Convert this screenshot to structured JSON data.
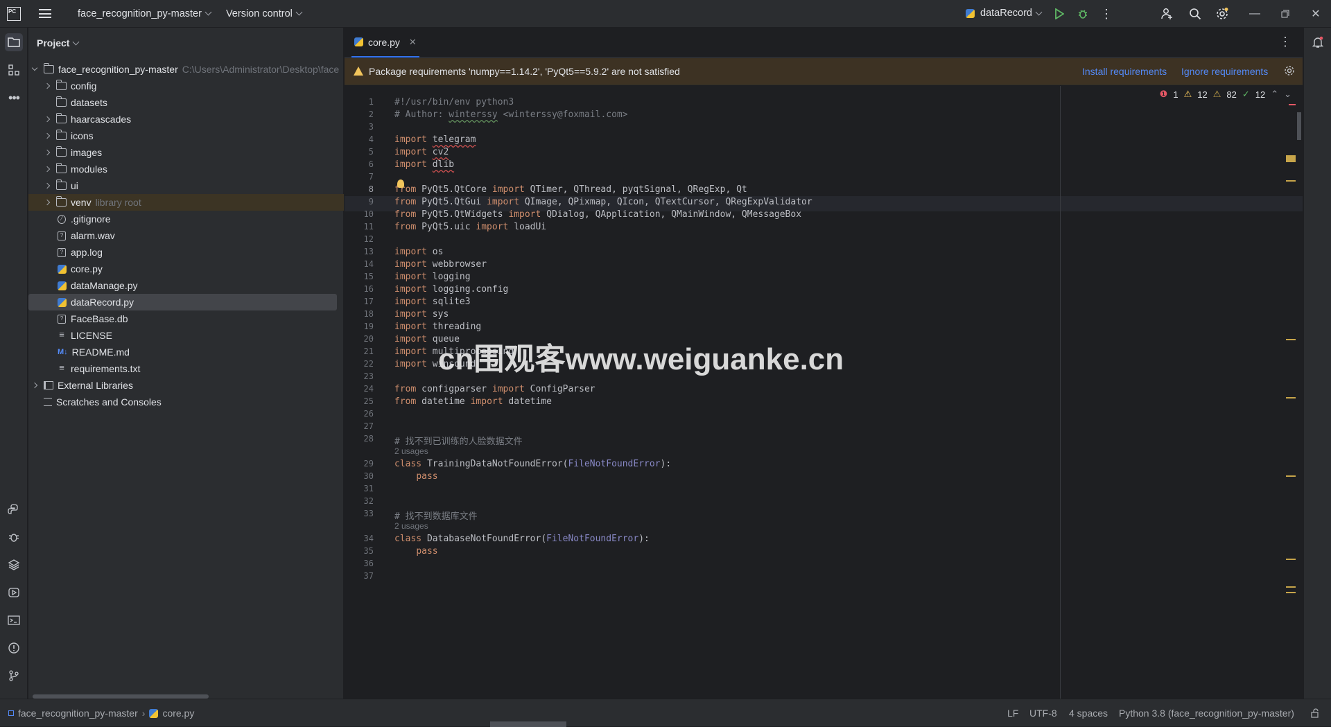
{
  "titlebar": {
    "project_name": "face_recognition_py-master",
    "vcs": "Version control",
    "run_config": "dataRecord",
    "logo_text": "PC"
  },
  "project_panel": {
    "title": "Project",
    "root": {
      "name": "face_recognition_py-master",
      "path": "C:\\Users\\Administrator\\Desktop\\face"
    },
    "items": [
      {
        "label": "config",
        "type": "folder",
        "arrow": true
      },
      {
        "label": "datasets",
        "type": "folder",
        "arrow": false
      },
      {
        "label": "haarcascades",
        "type": "folder",
        "arrow": true
      },
      {
        "label": "icons",
        "type": "folder",
        "arrow": true
      },
      {
        "label": "images",
        "type": "folder",
        "arrow": true
      },
      {
        "label": "modules",
        "type": "folder",
        "arrow": true
      },
      {
        "label": "ui",
        "type": "folder",
        "arrow": true
      },
      {
        "label": "venv",
        "type": "folder",
        "arrow": true,
        "note": "library root"
      },
      {
        "label": ".gitignore",
        "type": "ignore"
      },
      {
        "label": "alarm.wav",
        "type": "unknown"
      },
      {
        "label": "app.log",
        "type": "unknown"
      },
      {
        "label": "core.py",
        "type": "python"
      },
      {
        "label": "dataManage.py",
        "type": "python"
      },
      {
        "label": "dataRecord.py",
        "type": "python",
        "selected": true
      },
      {
        "label": "FaceBase.db",
        "type": "unknown"
      },
      {
        "label": "LICENSE",
        "type": "text"
      },
      {
        "label": "README.md",
        "type": "markdown"
      },
      {
        "label": "requirements.txt",
        "type": "text"
      }
    ],
    "external": "External Libraries",
    "scratches": "Scratches and Consoles"
  },
  "editor": {
    "tab": "core.py",
    "banner": {
      "message": "Package requirements 'numpy==1.14.2', 'PyQt5==5.9.2' are not satisfied",
      "install": "Install requirements",
      "ignore": "Ignore requirements"
    },
    "inspections": {
      "errors": "1",
      "warnings": "12",
      "weak": "82",
      "ok": "12"
    },
    "current_line": 8,
    "lines": [
      {
        "n": "1",
        "t": "#!/usr/bin/env python3"
      },
      {
        "n": "2",
        "t": "# Author: winterssy <winterssy@foxmail.com>"
      },
      {
        "n": "3",
        "t": ""
      },
      {
        "n": "4",
        "t": "import telegram"
      },
      {
        "n": "5",
        "t": "import cv2"
      },
      {
        "n": "6",
        "t": "import dlib"
      },
      {
        "n": "7",
        "t": ""
      },
      {
        "n": "8",
        "t": "from PyQt5.QtCore import QTimer, QThread, pyqtSignal, QRegExp, Qt"
      },
      {
        "n": "9",
        "t": "from PyQt5.QtGui import QImage, QPixmap, QIcon, QTextCursor, QRegExpValidator"
      },
      {
        "n": "10",
        "t": "from PyQt5.QtWidgets import QDialog, QApplication, QMainWindow, QMessageBox"
      },
      {
        "n": "11",
        "t": "from PyQt5.uic import loadUi"
      },
      {
        "n": "12",
        "t": ""
      },
      {
        "n": "13",
        "t": "import os"
      },
      {
        "n": "14",
        "t": "import webbrowser"
      },
      {
        "n": "15",
        "t": "import logging"
      },
      {
        "n": "16",
        "t": "import logging.config"
      },
      {
        "n": "17",
        "t": "import sqlite3"
      },
      {
        "n": "18",
        "t": "import sys"
      },
      {
        "n": "19",
        "t": "import threading"
      },
      {
        "n": "20",
        "t": "import queue"
      },
      {
        "n": "21",
        "t": "import multiprocessing"
      },
      {
        "n": "22",
        "t": "import winsound"
      },
      {
        "n": "23",
        "t": ""
      },
      {
        "n": "24",
        "t": "from configparser import ConfigParser"
      },
      {
        "n": "25",
        "t": "from datetime import datetime"
      },
      {
        "n": "26",
        "t": ""
      },
      {
        "n": "27",
        "t": ""
      },
      {
        "n": "28",
        "t": "# 找不到已训练的人脸数据文件"
      },
      {
        "n": "",
        "t": "2 usages"
      },
      {
        "n": "29",
        "t": "class TrainingDataNotFoundError(FileNotFoundError):"
      },
      {
        "n": "30",
        "t": "    pass"
      },
      {
        "n": "31",
        "t": ""
      },
      {
        "n": "32",
        "t": ""
      },
      {
        "n": "33",
        "t": "# 找不到数据库文件"
      },
      {
        "n": "",
        "t": "2 usages"
      },
      {
        "n": "34",
        "t": "class DatabaseNotFoundError(FileNotFoundError):"
      },
      {
        "n": "35",
        "t": "    pass"
      },
      {
        "n": "36",
        "t": ""
      },
      {
        "n": "37",
        "t": ""
      }
    ]
  },
  "statusbar": {
    "crumb_project": "face_recognition_py-master",
    "crumb_file": "core.py",
    "line_sep": "LF",
    "encoding": "UTF-8",
    "indent": "4 spaces",
    "interpreter": "Python 3.8 (face_recognition_py-master)"
  },
  "watermark": "cn围观客www.weiguanke.cn",
  "colors": {
    "accent": "#3574f0",
    "keyword": "#cf8e6d",
    "builtin": "#8888c6",
    "warning": "#f2c55c"
  }
}
